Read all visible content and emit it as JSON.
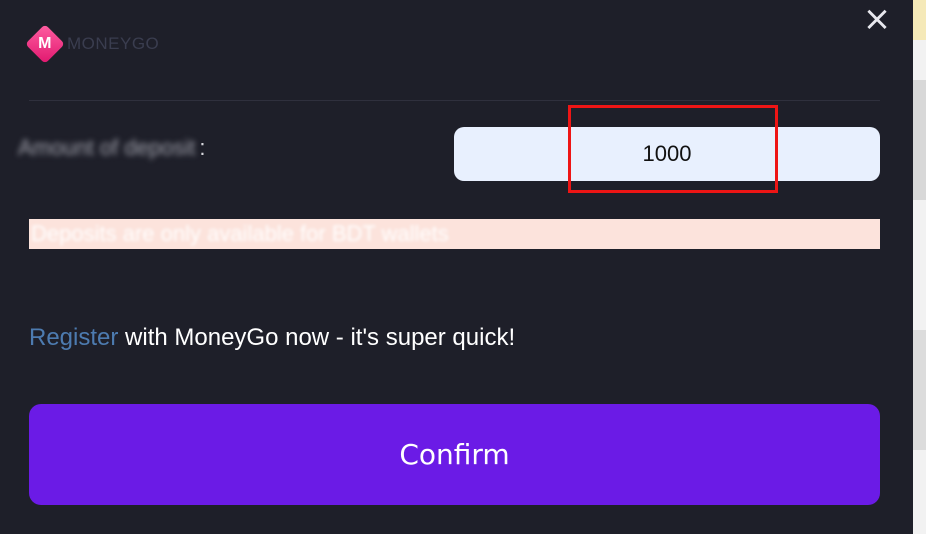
{
  "header": {
    "logo_letter": "M",
    "logo_text": "MONEYGO",
    "close_icon": "×"
  },
  "form": {
    "label": "Amount of deposit",
    "colon": ":",
    "amount_value": "1000"
  },
  "notice": {
    "text": "Deposits are only available for BDT wallets"
  },
  "register": {
    "link": "Register",
    "text": " with MoneyGo now - it's super quick!"
  },
  "actions": {
    "confirm_label": "Confirm"
  },
  "colors": {
    "background": "#1e1f29",
    "button": "#6b1be6",
    "input_bg": "#e8f0fe",
    "highlight": "#ee1515",
    "notice_bg": "#fce3dc",
    "link": "#4d7bb0",
    "logo": "#e0176e"
  }
}
